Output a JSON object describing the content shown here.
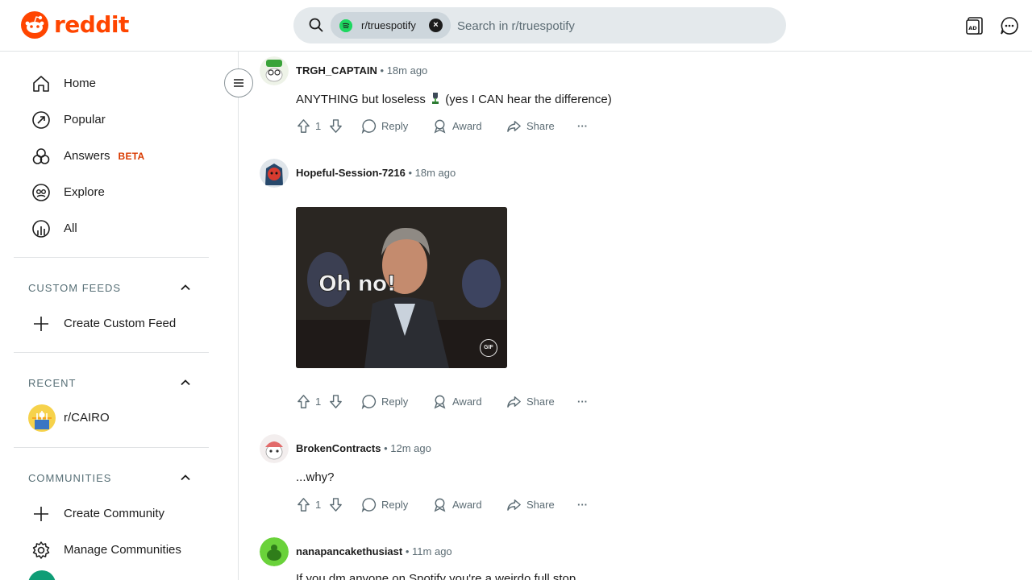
{
  "header": {
    "logo_text": "reddit",
    "search_chip_label": "r/truespotify",
    "search_chip_close": "×",
    "search_placeholder": "Search in r/truespotify"
  },
  "sidebar": {
    "nav": [
      {
        "label": "Home",
        "icon": "home-icon"
      },
      {
        "label": "Popular",
        "icon": "popular-icon"
      },
      {
        "label": "Answers",
        "icon": "answers-icon",
        "badge": "BETA"
      },
      {
        "label": "Explore",
        "icon": "explore-icon"
      },
      {
        "label": "All",
        "icon": "all-icon"
      }
    ],
    "custom_feeds": {
      "title": "CUSTOM FEEDS",
      "create_label": "Create Custom Feed"
    },
    "recent": {
      "title": "RECENT",
      "items": [
        {
          "label": "r/CAIRO"
        }
      ]
    },
    "communities": {
      "title": "COMMUNITIES",
      "create_label": "Create Community",
      "manage_label": "Manage Communities"
    }
  },
  "comments": [
    {
      "author": "TRGH_CAPTAIN",
      "time": "18m ago",
      "text": "ANYTHING but loseless",
      "text_after_emoji": "(yes I CAN hear the difference)",
      "votes": "1"
    },
    {
      "author": "Hopeful-Session-7216",
      "time": "18m ago",
      "gif_caption": "Oh no!",
      "gif_badge": "GIF",
      "votes": "1"
    },
    {
      "author": "BrokenContracts",
      "time": "12m ago",
      "text": "...why?",
      "votes": "1"
    },
    {
      "author": "nanapancakethusiast",
      "time": "11m ago",
      "text": "If you dm anyone on Spotify you're a weirdo full stop"
    }
  ],
  "actions": {
    "reply": "Reply",
    "award": "Award",
    "share": "Share",
    "more": "···"
  },
  "separator": "•",
  "colors": {
    "brand": "#ff4500",
    "beta": "#d93a00",
    "spotify": "#1ed760"
  }
}
